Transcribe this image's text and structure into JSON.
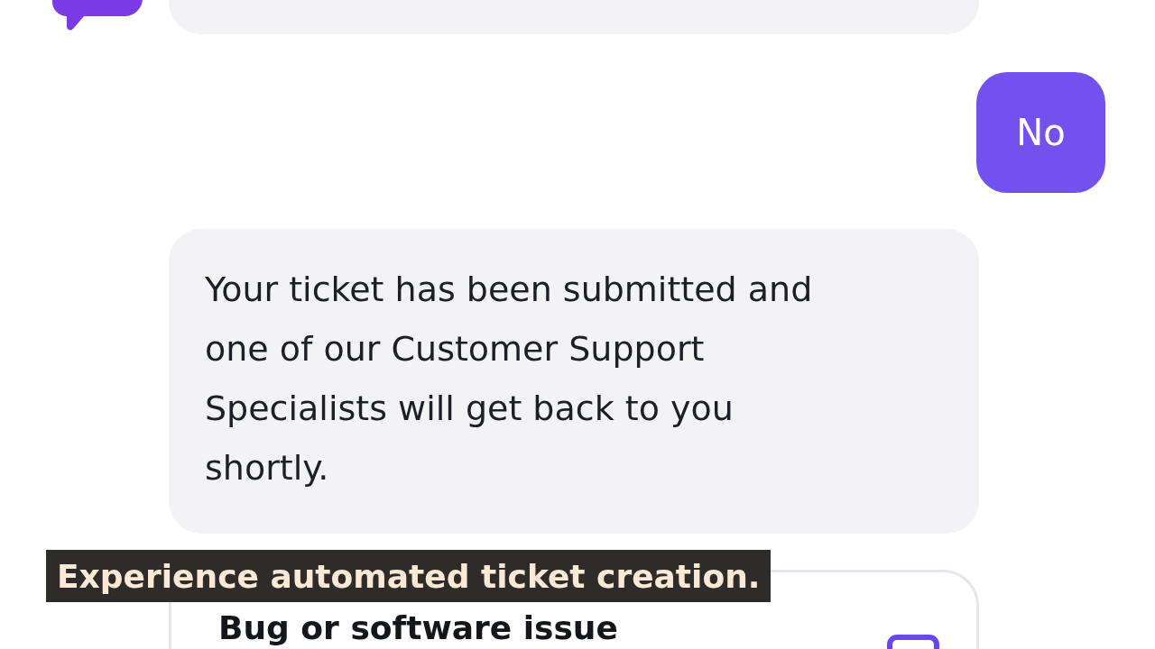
{
  "messages": [
    {
      "kind": "bot-cut"
    },
    {
      "kind": "user",
      "text": "No"
    },
    {
      "kind": "bot",
      "text": "Your ticket has been submitted and one of our Customer Support Specialists will get back to you shortly."
    },
    {
      "kind": "card",
      "title": "Bug or software issue"
    }
  ],
  "caption": "Experience automated ticket creation."
}
